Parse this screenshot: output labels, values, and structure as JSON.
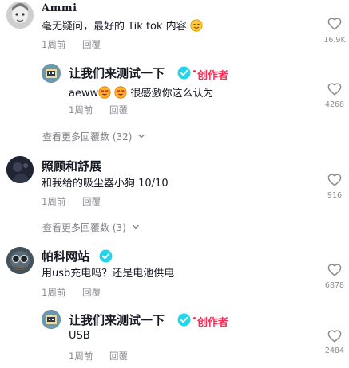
{
  "comments": [
    {
      "author": "Ammi",
      "text": "毫无疑问，最好的 Tik tok 内容",
      "time": "1周前",
      "reply_label": "回覆",
      "likes": "16.9K"
    },
    {
      "author": "让我们来测试一下",
      "creator_label": "创作者",
      "text": "aeww",
      "text_after": "很感激你这么认为",
      "time": "1周前",
      "reply_label": "回覆",
      "likes": "4268"
    },
    {
      "more_replies": "查看更多回覆数 (32)"
    },
    {
      "author": "照顾和舒展",
      "text": "和我给的吸尘器小狗 10/10",
      "time": "1周前",
      "reply_label": "回覆",
      "likes": "916"
    },
    {
      "more_replies": "查看更多回覆数 (3)"
    },
    {
      "author": "帕科网站",
      "text": "用usb充电吗？还是电池供电",
      "time": "1周前",
      "reply_label": "回覆",
      "likes": "6878"
    },
    {
      "author": "让我们来测试一下",
      "creator_label": "创作者",
      "text": "USB",
      "time": "1周前",
      "reply_label": "回覆",
      "likes": "2484"
    }
  ],
  "colors": {
    "creator": "#fe2c55",
    "verified": "#20d5ec",
    "muted": "#8a8b91"
  }
}
